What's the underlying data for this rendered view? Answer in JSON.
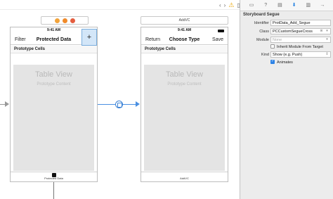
{
  "inspector": {
    "section_title": "Storyboard Segue",
    "identifier": {
      "label": "Identifier",
      "value": "ProtData_Add_Segue"
    },
    "class": {
      "label": "Class",
      "value": "PCCustomSegueCross"
    },
    "module": {
      "label": "Module",
      "placeholder": "None"
    },
    "inherit": {
      "label": "Inherit Module From Target",
      "checked": false
    },
    "kind": {
      "label": "Kind",
      "value": "Show (e.g. Push)"
    },
    "animates": {
      "label": "Animates",
      "checked": true
    }
  },
  "toolbar": {
    "back": "‹",
    "forward": "›",
    "warning": "⚠",
    "extra": "▯"
  },
  "scene1": {
    "time": "9:41 AM",
    "nav_left": "Filter",
    "nav_title": "Protected Data",
    "add_label": "+",
    "section": "Prototype Cells",
    "table_title": "Table View",
    "table_sub": "Prototype Content",
    "label": "Protected Data"
  },
  "scene2": {
    "bar_title": "AddVC",
    "time": "9:41 AM",
    "nav_left": "Return",
    "nav_title": "Choose Type",
    "nav_right": "Save",
    "section": "Prototype Cells",
    "table_title": "Table View",
    "table_sub": "Prototype Content",
    "label": "AddVC"
  },
  "colors": {
    "accent": "#4a90e2",
    "selected": "#d3e6f8",
    "checkbox": "#2d83e6",
    "warning": "#e8a400"
  }
}
